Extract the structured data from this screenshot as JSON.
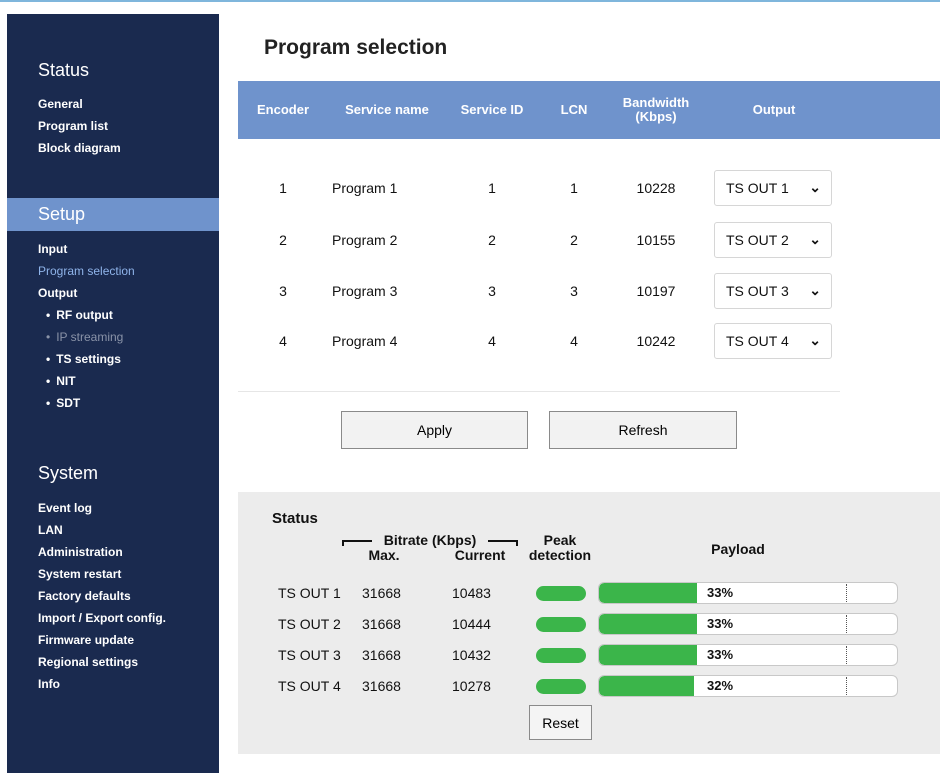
{
  "sidebar": {
    "status_title": "Status",
    "status_items": [
      "General",
      "Program list",
      "Block diagram"
    ],
    "setup_title": "Setup",
    "setup_items": [
      {
        "label": "Input"
      },
      {
        "label": "Program selection",
        "state": "active"
      },
      {
        "label": "Output"
      }
    ],
    "output_subitems": [
      {
        "label": "RF output"
      },
      {
        "label": "IP streaming",
        "state": "disabled"
      },
      {
        "label": "TS settings"
      },
      {
        "label": "NIT"
      },
      {
        "label": "SDT"
      }
    ],
    "system_title": "System",
    "system_items": [
      "Event log",
      "LAN",
      "Administration",
      "System restart",
      "Factory defaults",
      "Import / Export config.",
      "Firmware update",
      "Regional settings",
      "Info"
    ]
  },
  "page": {
    "title": "Program selection"
  },
  "program_table": {
    "headers": [
      "Encoder",
      "Service name",
      "Service ID",
      "LCN",
      "Bandwidth\n(Kbps)",
      "Output"
    ],
    "rows": [
      {
        "encoder": "1",
        "service_name": "Program 1",
        "service_id": "1",
        "lcn": "1",
        "bandwidth": "10228",
        "output": "TS OUT 1"
      },
      {
        "encoder": "2",
        "service_name": "Program 2",
        "service_id": "2",
        "lcn": "2",
        "bandwidth": "10155",
        "output": "TS OUT 2"
      },
      {
        "encoder": "3",
        "service_name": "Program 3",
        "service_id": "3",
        "lcn": "3",
        "bandwidth": "10197",
        "output": "TS OUT 3"
      },
      {
        "encoder": "4",
        "service_name": "Program 4",
        "service_id": "4",
        "lcn": "4",
        "bandwidth": "10242",
        "output": "TS OUT 4"
      }
    ]
  },
  "buttons": {
    "apply": "Apply",
    "refresh": "Refresh",
    "reset": "Reset"
  },
  "status": {
    "title": "Status",
    "bitrate_label": "Bitrate (Kbps)",
    "max_label": "Max.",
    "current_label": "Current",
    "peak_label": "Peak\ndetection",
    "payload_label": "Payload",
    "rows": [
      {
        "name": "TS OUT 1",
        "max": "31668",
        "current": "10483",
        "payload_text": "33%",
        "payload": 0.33
      },
      {
        "name": "TS OUT 2",
        "max": "31668",
        "current": "10444",
        "payload_text": "33%",
        "payload": 0.33
      },
      {
        "name": "TS OUT 3",
        "max": "31668",
        "current": "10432",
        "payload_text": "33%",
        "payload": 0.33
      },
      {
        "name": "TS OUT 4",
        "max": "31668",
        "current": "10278",
        "payload_text": "32%",
        "payload": 0.32
      }
    ]
  },
  "colors": {
    "sidebar_bg": "#1a2a4f",
    "accent_blue": "#6f93cc",
    "ok_green": "#3bb54a"
  }
}
